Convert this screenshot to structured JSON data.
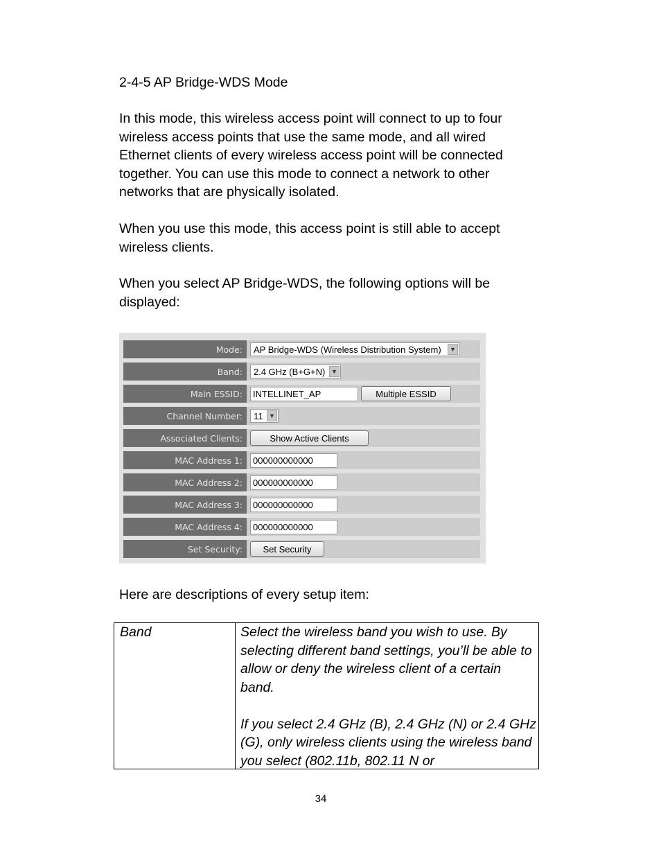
{
  "section": {
    "heading": "2-4-5 AP Bridge-WDS Mode",
    "paragraphs": [
      "In this mode, this wireless access point will connect to up to four wireless access points that use the same mode, and all wired Ethernet clients of every wireless access point will be connected together. You can use this mode to connect a network to other networks that are physically isolated.",
      "When you use this mode, this access point is still able to accept wireless clients.",
      "When you select AP Bridge-WDS, the following options will be displayed:",
      "Here are descriptions of every setup item:"
    ]
  },
  "form": {
    "mode": {
      "label": "Mode:",
      "value": "AP Bridge-WDS (Wireless Distribution System)"
    },
    "band": {
      "label": "Band:",
      "value": "2.4 GHz (B+G+N)"
    },
    "essid": {
      "label": "Main ESSID:",
      "value": "INTELLINET_AP",
      "button": "Multiple ESSID"
    },
    "channel": {
      "label": "Channel Number:",
      "value": "11"
    },
    "clients": {
      "label": "Associated Clients:",
      "button": "Show Active Clients"
    },
    "mac": [
      {
        "label": "MAC Address 1:",
        "value": "000000000000"
      },
      {
        "label": "MAC Address 2:",
        "value": "000000000000"
      },
      {
        "label": "MAC Address 3:",
        "value": "000000000000"
      },
      {
        "label": "MAC Address 4:",
        "value": "000000000000"
      }
    ],
    "security": {
      "label": "Set Security:",
      "button": "Set Security"
    },
    "dropdown_icon": "chevron-down-icon"
  },
  "table": {
    "term": "Band",
    "description": [
      "Select the wireless band you wish to use. By selecting different band settings, you’ll be able to allow or deny the wireless client of a certain band.",
      "If you select 2.4 GHz (B), 2.4 GHz (N) or 2.4 GHz (G), only wireless clients using the wireless band you select (802.11b, 802.11 N or"
    ]
  },
  "page_number": "34"
}
